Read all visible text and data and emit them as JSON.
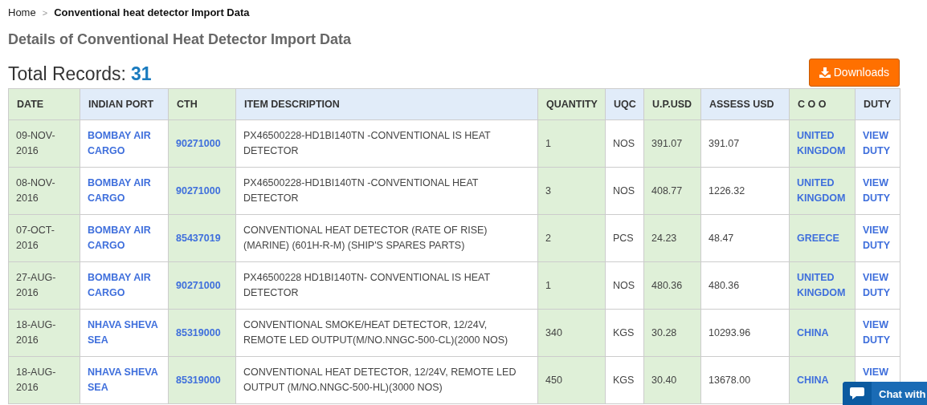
{
  "breadcrumb": {
    "home": "Home",
    "separator": ">",
    "current": "Conventional heat detector Import Data"
  },
  "heading": "Details of Conventional Heat Detector Import Data",
  "total_records": {
    "label": "Total Records:",
    "value": "31"
  },
  "downloads_button": "Downloads",
  "table": {
    "columns": [
      {
        "label": "DATE",
        "kind": "text"
      },
      {
        "label": "INDIAN PORT",
        "kind": "link"
      },
      {
        "label": "CTH",
        "kind": "link"
      },
      {
        "label": "ITEM DESCRIPTION",
        "kind": "text"
      },
      {
        "label": "QUANTITY",
        "kind": "text"
      },
      {
        "label": "UQC",
        "kind": "text"
      },
      {
        "label": "U.P.USD",
        "kind": "text"
      },
      {
        "label": "ASSESS USD",
        "kind": "text"
      },
      {
        "label": "C O O",
        "kind": "link"
      },
      {
        "label": "DUTY",
        "kind": "link"
      }
    ],
    "rows": [
      [
        "09-NOV-2016",
        "BOMBAY AIR CARGO",
        "90271000",
        "PX46500228-HD1BI140TN -CONVENTIONAL IS HEAT DETECTOR",
        "1",
        "NOS",
        "391.07",
        "391.07",
        "UNITED KINGDOM",
        "VIEW DUTY"
      ],
      [
        "08-NOV-2016",
        "BOMBAY AIR CARGO",
        "90271000",
        "PX46500228-HD1BI140TN -CONVENTIONAL HEAT DETECTOR",
        "3",
        "NOS",
        "408.77",
        "1226.32",
        "UNITED KINGDOM",
        "VIEW DUTY"
      ],
      [
        "07-OCT-2016",
        "BOMBAY AIR CARGO",
        "85437019",
        "CONVENTIONAL HEAT DETECTOR (RATE OF RISE) (MARINE) (601H-R-M) (SHIP'S SPARES PARTS)",
        "2",
        "PCS",
        "24.23",
        "48.47",
        "GREECE",
        "VIEW DUTY"
      ],
      [
        "27-AUG-2016",
        "BOMBAY AIR CARGO",
        "90271000",
        "PX46500228 HD1BI140TN- CONVENTIONAL IS HEAT DETECTOR",
        "1",
        "NOS",
        "480.36",
        "480.36",
        "UNITED KINGDOM",
        "VIEW DUTY"
      ],
      [
        "18-AUG-2016",
        "NHAVA SHEVA SEA",
        "85319000",
        "CONVENTIONAL SMOKE/HEAT DETECTOR, 12/24V, REMOTE LED OUTPUT(M/NO.NNGC-500-CL)(2000 NOS)",
        "340",
        "KGS",
        "30.28",
        "10293.96",
        "CHINA",
        "VIEW DUTY"
      ],
      [
        "18-AUG-2016",
        "NHAVA SHEVA SEA",
        "85319000",
        "CONVENTIONAL HEAT DETECTOR, 12/24V, REMOTE LED OUTPUT (M/NO.NNGC-500-HL)(3000 NOS)",
        "450",
        "KGS",
        "30.40",
        "13678.00",
        "CHINA",
        "VIEW"
      ]
    ]
  },
  "chat_widget": {
    "label": "Chat with"
  }
}
